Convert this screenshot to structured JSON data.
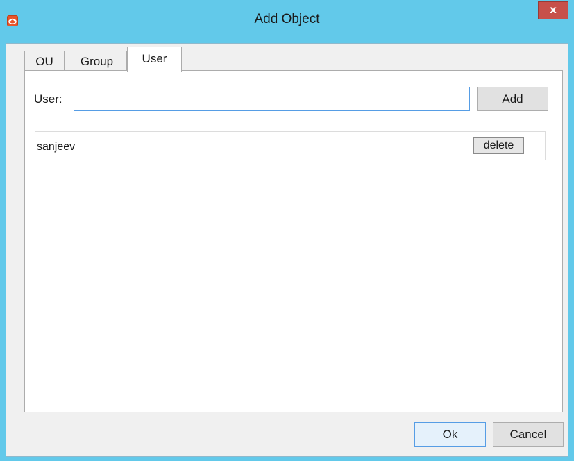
{
  "window": {
    "title": "Add Object",
    "close_label": "x",
    "app_icon": "app-logo-icon"
  },
  "tabs": [
    {
      "label": "OU",
      "active": false
    },
    {
      "label": "Group",
      "active": false
    },
    {
      "label": "User",
      "active": true
    }
  ],
  "user_tab": {
    "field_label": "User:",
    "input_value": "",
    "input_placeholder": "",
    "add_label": "Add",
    "users": [
      {
        "name": "sanjeev",
        "delete_label": "delete"
      }
    ]
  },
  "footer": {
    "ok_label": "Ok",
    "cancel_label": "Cancel"
  },
  "colors": {
    "title_bar": "#62c9ea",
    "close_button": "#c7504a",
    "focus_border": "#569de5"
  }
}
